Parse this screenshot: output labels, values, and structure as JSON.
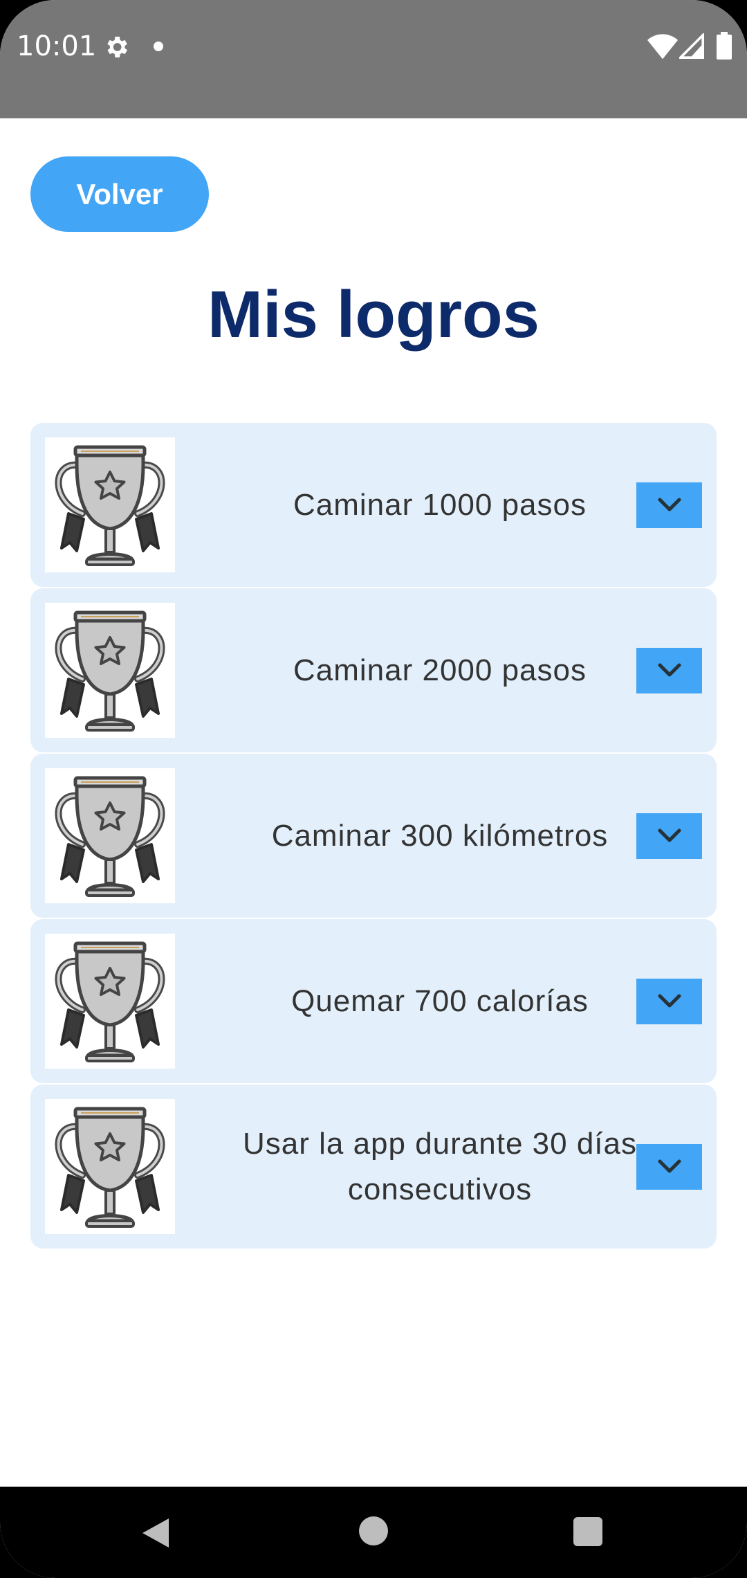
{
  "status_bar": {
    "time": "10:01"
  },
  "header": {
    "back_label": "Volver",
    "title": "Mis logros"
  },
  "achievements": [
    {
      "label": "Caminar 1000 pasos"
    },
    {
      "label": "Caminar 2000 pasos"
    },
    {
      "label": "Caminar 300 kilómetros"
    },
    {
      "label": "Quemar 700 calorías"
    },
    {
      "label": "Usar la app durante 30 días consecutivos"
    }
  ],
  "icons": {
    "trophy": "trophy-icon",
    "expand": "chevron-down-icon"
  },
  "colors": {
    "accent": "#42a5f5",
    "title": "#0d2a6b",
    "card_background": "#e3f0fb",
    "status_bar": "#777777"
  }
}
